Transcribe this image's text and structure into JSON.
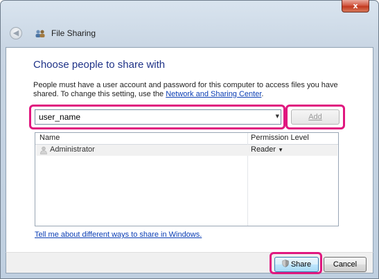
{
  "window": {
    "close_label": "x",
    "title": "File Sharing"
  },
  "nav": {
    "back_glyph": "◀"
  },
  "dialog": {
    "heading": "Choose people to share with",
    "description_before": "People must have a user account and password for this computer to access files you have shared.  To change this setting, use the ",
    "description_link": "Network and Sharing Center",
    "description_after": "."
  },
  "user_combo": {
    "value": "user_name",
    "arrow": "▼"
  },
  "add_button": {
    "label": "Add",
    "enabled": false
  },
  "list": {
    "columns": [
      "Name",
      "Permission Level"
    ],
    "rows": [
      {
        "name": "Administrator",
        "permission": "Reader",
        "permission_arrow": "▼"
      }
    ]
  },
  "help_link": "Tell me about different ways to share in Windows.",
  "footer": {
    "share_label": "Share",
    "cancel_label": "Cancel"
  },
  "icons": {
    "back": "back-arrow-icon",
    "title": "file-sharing-icon",
    "user": "user-icon",
    "share": "uac-shield-icon"
  },
  "colors": {
    "highlight": "#e0177f",
    "heading": "#1e3287",
    "link": "#0a3db4"
  }
}
